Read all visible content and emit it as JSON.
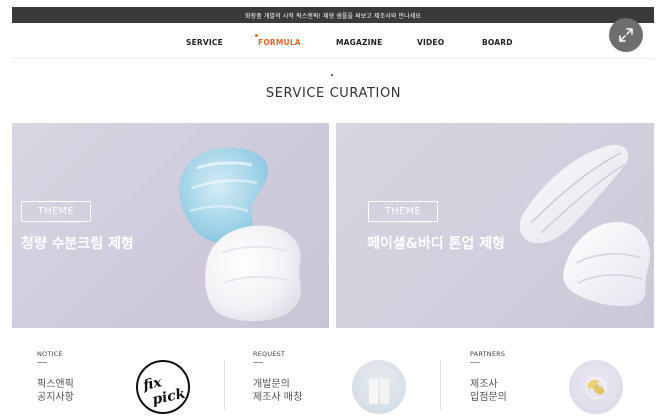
{
  "topbar": {
    "text": "화장품 개발의 시작 픽스앤픽! 제형 샘플을 써보고 제조사와 만나세요"
  },
  "nav": {
    "items": [
      {
        "label": "SERVICE"
      },
      {
        "label": "FORMULA",
        "active": true
      },
      {
        "label": "MAGAZINE"
      },
      {
        "label": "VIDEO"
      },
      {
        "label": "BOARD"
      }
    ],
    "expand_icon": "expand-arrows-icon"
  },
  "section": {
    "title": "SERVICE CURATION"
  },
  "cards": [
    {
      "tag": "THEME",
      "title": "청량 수분크림 제형"
    },
    {
      "tag": "THEME",
      "title": "페이셜&바디 톤업 제형"
    }
  ],
  "info": [
    {
      "label": "NOTICE",
      "line1": "픽스앤픽",
      "line2": "공지사항",
      "logo_text": "fix pick"
    },
    {
      "label": "REQUEST",
      "line1": "개발문의",
      "line2": "제조사 매칭"
    },
    {
      "label": "PARTNERS",
      "line1": "제조사",
      "line2": "입점문의"
    }
  ],
  "colors": {
    "accent": "#e06a2b",
    "topbar": "#3a3a3c",
    "card_bg": "#d3d0de"
  }
}
